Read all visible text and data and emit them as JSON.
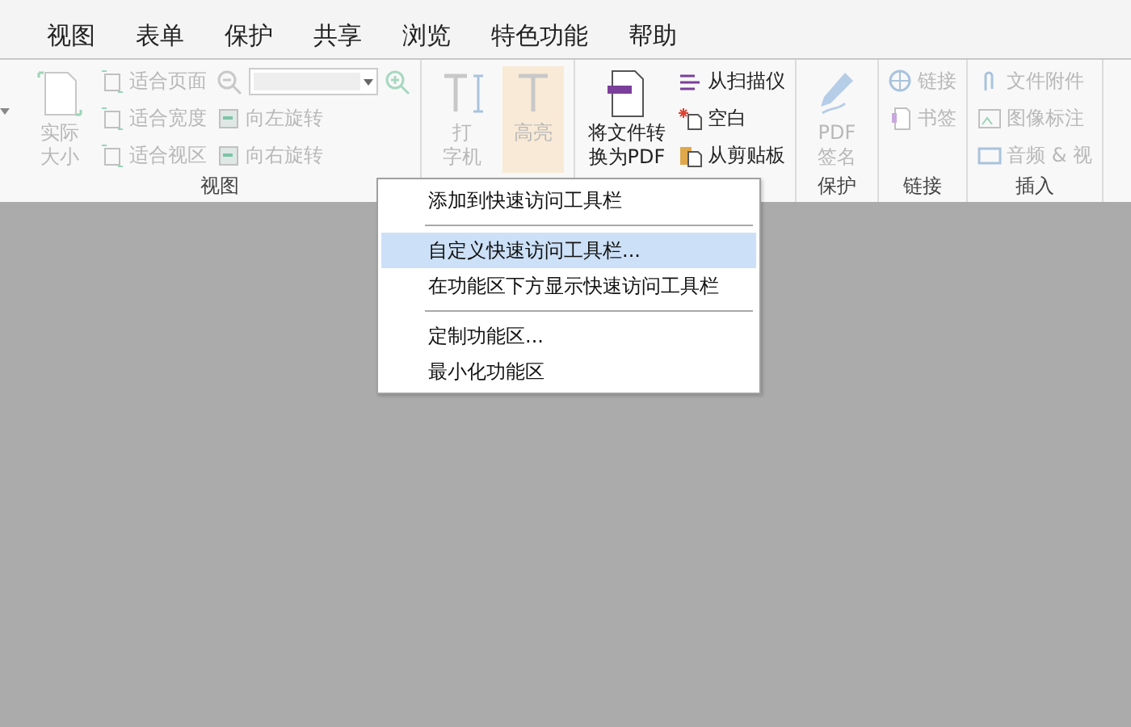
{
  "tabs": [
    {
      "label": "视图",
      "selected": false
    },
    {
      "label": "表单",
      "selected": false
    },
    {
      "label": "保护",
      "selected": false
    },
    {
      "label": "共享",
      "selected": false
    },
    {
      "label": "浏览",
      "selected": false
    },
    {
      "label": "特色功能",
      "selected": false
    },
    {
      "label": "帮助",
      "selected": false
    }
  ],
  "ribbon": {
    "groups": [
      {
        "label": "视图",
        "large": [
          {
            "lines": [
              "实际",
              "大小"
            ],
            "disabled": true
          }
        ],
        "small_columns": [
          [
            {
              "label": "适合页面",
              "disabled": true
            },
            {
              "label": "适合宽度",
              "disabled": true
            },
            {
              "label": "适合视区",
              "disabled": true
            }
          ],
          [
            {
              "kind": "zoom",
              "disabled": true
            },
            {
              "kind": "button",
              "label": "向左旋转",
              "disabled": true
            },
            {
              "kind": "button",
              "label": "向右旋转",
              "disabled": true
            }
          ]
        ]
      },
      {
        "large": [
          {
            "lines": [
              "打",
              "字机"
            ],
            "disabled": true
          },
          {
            "lines": [
              "高亮"
            ],
            "disabled": true
          }
        ]
      },
      {
        "large": [
          {
            "lines": [
              "将文件转",
              "换为PDF"
            ],
            "disabled": false
          }
        ],
        "small_columns": [
          [
            {
              "label": "从扫描仪",
              "disabled": false
            },
            {
              "label": "空白",
              "disabled": false
            },
            {
              "label": "从剪贴板",
              "disabled": false
            }
          ]
        ]
      },
      {
        "label": "保护",
        "large": [
          {
            "lines": [
              "PDF",
              "签名"
            ],
            "disabled": true
          }
        ]
      },
      {
        "label": "链接",
        "small_columns": [
          [
            {
              "label": "链接",
              "disabled": true
            },
            {
              "label": "书签",
              "disabled": true
            }
          ]
        ]
      },
      {
        "label": "插入",
        "small_columns": [
          [
            {
              "label": "文件附件",
              "disabled": true
            },
            {
              "label": "图像标注",
              "disabled": true
            },
            {
              "label": "音频 & 视",
              "disabled": true
            }
          ]
        ]
      }
    ]
  },
  "context_menu": {
    "items": [
      {
        "kind": "item",
        "label": "添加到快速访问工具栏",
        "selected": false
      },
      {
        "kind": "separator"
      },
      {
        "kind": "item",
        "label": "自定义快速访问工具栏...",
        "selected": true
      },
      {
        "kind": "item",
        "label": "在功能区下方显示快速访问工具栏",
        "selected": false
      },
      {
        "kind": "separator"
      },
      {
        "kind": "item",
        "label": "定制功能区...",
        "selected": false
      },
      {
        "kind": "item",
        "label": "最小化功能区",
        "selected": false
      }
    ]
  }
}
